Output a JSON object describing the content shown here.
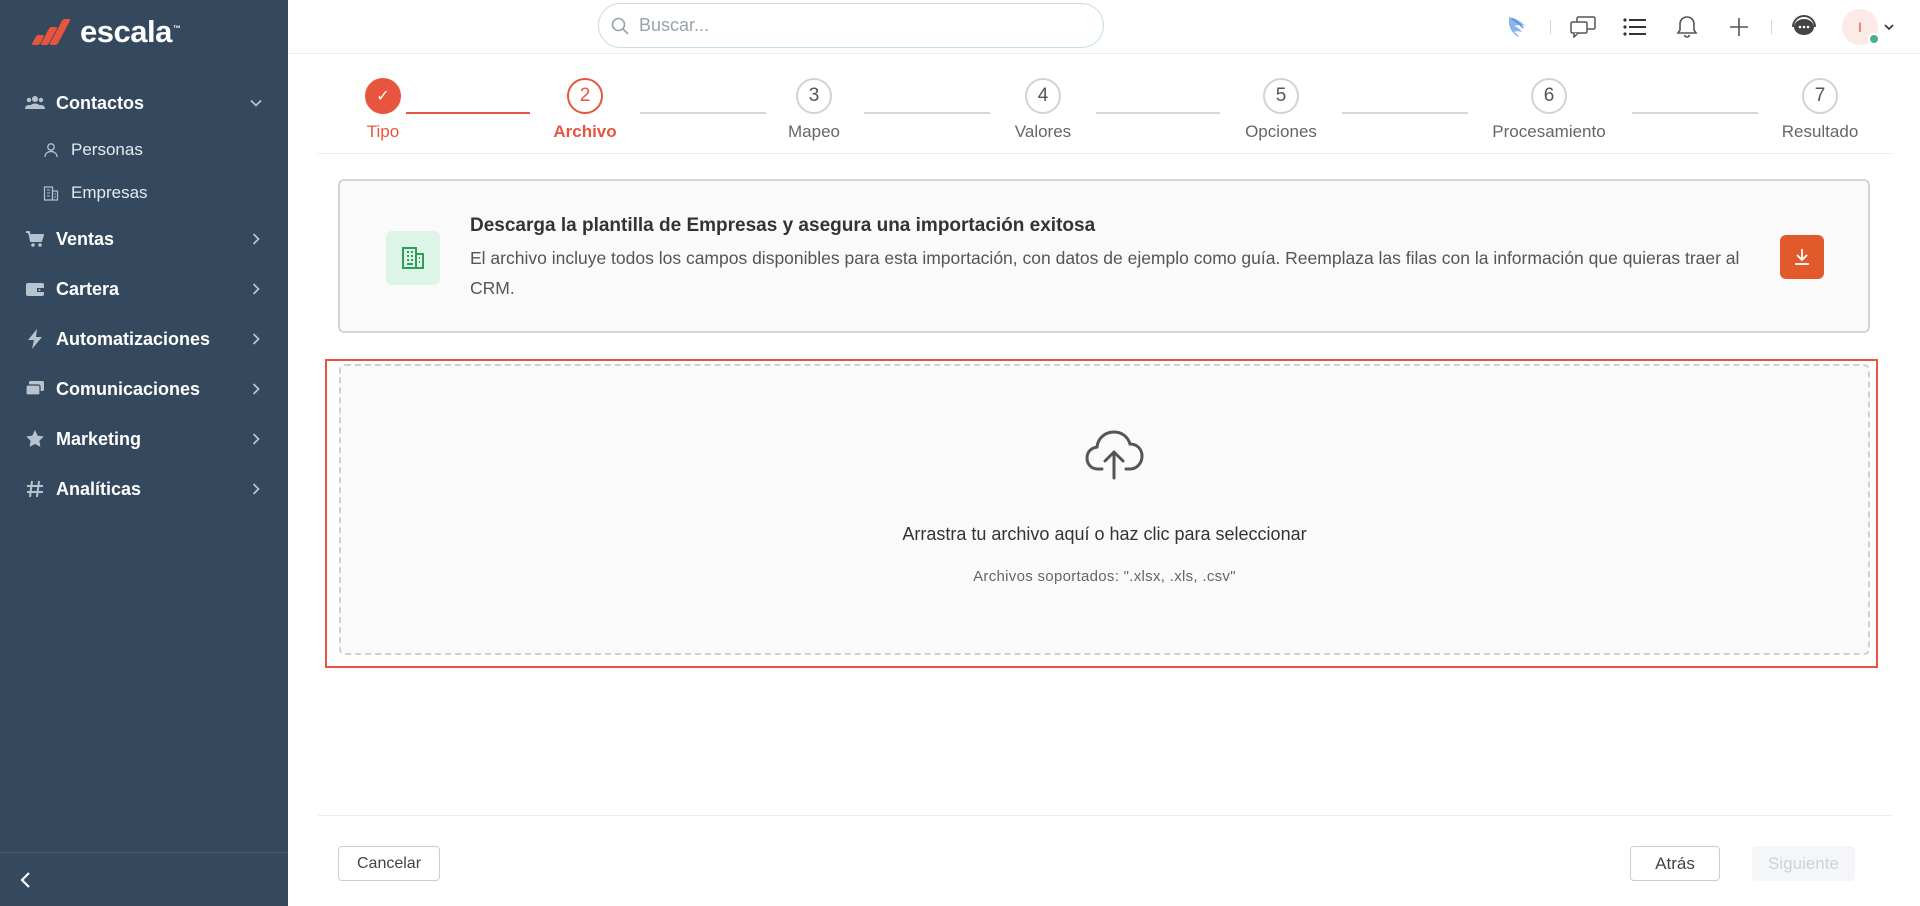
{
  "brand": {
    "name": "escala",
    "tm": "™",
    "accent": "#e8553e",
    "sidebar_bg": "#34495e"
  },
  "sidebar": {
    "sections": [
      {
        "label": "Contactos",
        "icon": "users-icon",
        "expanded": true,
        "children": [
          {
            "label": "Personas",
            "icon": "person-icon"
          },
          {
            "label": "Empresas",
            "icon": "building-icon"
          }
        ]
      },
      {
        "label": "Ventas",
        "icon": "cart-icon"
      },
      {
        "label": "Cartera",
        "icon": "wallet-icon"
      },
      {
        "label": "Automatizaciones",
        "icon": "bolt-icon"
      },
      {
        "label": "Comunicaciones",
        "icon": "chat-icon"
      },
      {
        "label": "Marketing",
        "icon": "star-icon"
      },
      {
        "label": "Analíticas",
        "icon": "hash-icon"
      }
    ]
  },
  "topbar": {
    "search_placeholder": "Buscar...",
    "avatar_initial": "I"
  },
  "stepper": {
    "steps": [
      {
        "number": "✓",
        "label": "Tipo",
        "state": "done"
      },
      {
        "number": "2",
        "label": "Archivo",
        "state": "active"
      },
      {
        "number": "3",
        "label": "Mapeo",
        "state": "pending"
      },
      {
        "number": "4",
        "label": "Valores",
        "state": "pending"
      },
      {
        "number": "5",
        "label": "Opciones",
        "state": "pending"
      },
      {
        "number": "6",
        "label": "Procesamiento",
        "state": "pending"
      },
      {
        "number": "7",
        "label": "Resultado",
        "state": "pending"
      }
    ]
  },
  "template_card": {
    "title": "Descarga la plantilla de Empresas y asegura una importación exitosa",
    "description": "El archivo incluye todos los campos disponibles para esta importación, con datos de ejemplo como guía. Reemplaza las filas con la información que quieras traer al CRM."
  },
  "dropzone": {
    "text": "Arrastra tu archivo aquí o haz clic para seleccionar",
    "supported": "Archivos soportados: \".xlsx, .xls, .csv\""
  },
  "footer": {
    "cancel_label": "Cancelar",
    "back_label": "Atrás",
    "next_label": "Siguiente"
  }
}
